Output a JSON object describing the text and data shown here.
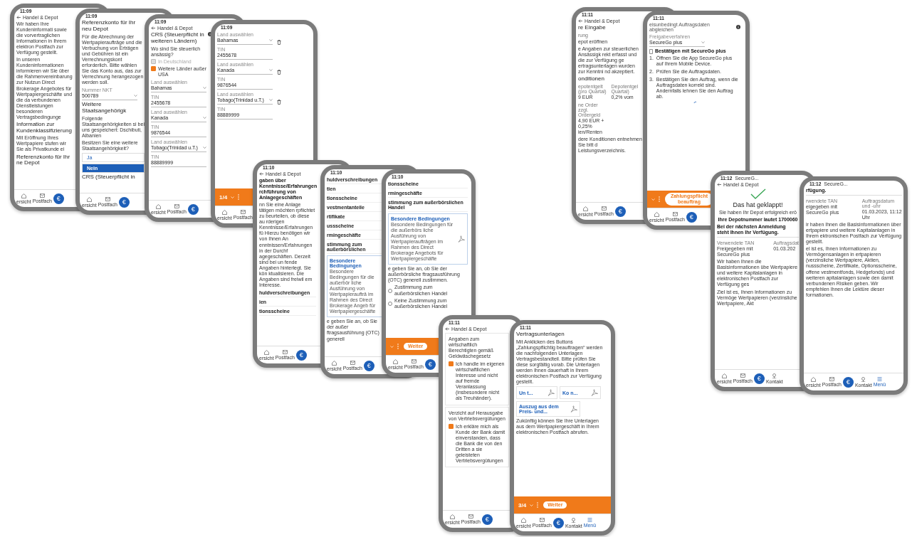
{
  "phones": [
    {
      "time": "11:09",
      "items": [
        {
          "kind": "header",
          "text": "Handel & Depot"
        },
        {
          "kind": "para",
          "text": "Wir haben Ihre Kundeninformati sowie die vorvertraglichen Informationen in Ihrem elektron Postfach zur Verfügung gestellt."
        },
        {
          "kind": "para",
          "text": "In unseren Kundeninformationen informieren wir Sie über die Rahmenvereinbarung zur Nutzun Direct Brokerage Angebotes für Wertpapiergeschäfte und die da verbundenen Dienstleistungen besonderen Vertragsbedingunge"
        },
        {
          "kind": "heading",
          "text": "Information zur Kundenklassifizierung"
        },
        {
          "kind": "para",
          "text": "Mit Eröffnung Ihres Wertpapiere stufen wir Sie als Privatkunde ei"
        },
        {
          "kind": "heading",
          "text": "Referenzkonto für Ihr ne Depot"
        }
      ],
      "nav": {
        "items": [
          {
            "kind": "home",
            "label": "ersicht",
            "selected": false
          },
          {
            "kind": "mail",
            "label": "Postfach",
            "selected": false
          }
        ],
        "fab": "€"
      }
    },
    {
      "time": "11:09",
      "items": [
        {
          "kind": "heading",
          "text": "Referenzkonto für Ihr neu Depot"
        },
        {
          "kind": "para",
          "text": "Für die Abrechnung der Wertpapieraufträge und die Verbuchung von Erträgen und Gebühren ist ein Verrechnungskont erforderlich. Bitte wählen Sie das Konto aus, das zur Verrechnung herangezogen werden soll."
        },
        {
          "kind": "select",
          "label": "Nummer NKT",
          "value": "500789"
        },
        {
          "kind": "heading",
          "text": "Weitere Staatsangehörigk"
        },
        {
          "kind": "para",
          "text": "Folgende Staatsangehörigkeiten si bei uns gespeichert: Dschibuti, Albanien"
        },
        {
          "kind": "para",
          "text": "Besitzen Sie eine weitere Staatsangehörigkeit?"
        },
        {
          "kind": "option",
          "text": "Ja",
          "selected": false
        },
        {
          "kind": "option",
          "text": "Nein",
          "selected": true
        },
        {
          "kind": "heading",
          "text": "CRS (Steuerpflicht in"
        }
      ],
      "nav": {
        "items": [
          {
            "kind": "home",
            "label": "ersicht",
            "selected": false
          },
          {
            "kind": "mail",
            "label": "Postfach",
            "selected": false
          }
        ],
        "fab": "€"
      }
    },
    {
      "time": "11:09",
      "items": [
        {
          "kind": "header",
          "text": "Handel & Depot"
        },
        {
          "kind": "heading_info",
          "text": "CRS (Steuerpflicht in weiteren Ländern)"
        },
        {
          "kind": "para",
          "text": "Wo sind Sie steuerlich ansässig?"
        },
        {
          "kind": "checkbox",
          "text": "In Deutschland",
          "checked": true,
          "disabled": true
        },
        {
          "kind": "checkbox",
          "text": "Weitere Länder außer USA",
          "checked": true,
          "disabled": false
        },
        {
          "kind": "select",
          "label": "Land auswählen",
          "value": "Bahamas"
        },
        {
          "kind": "text_input",
          "label": "TIN",
          "value": "2455678"
        },
        {
          "kind": "select",
          "label": "Land auswählen",
          "value": "Kanada"
        },
        {
          "kind": "text_input",
          "label": "TIN",
          "value": "9876544"
        },
        {
          "kind": "select",
          "label": "Land auswählen",
          "value": "Tobago(Trinidad u.T.)"
        },
        {
          "kind": "text_input",
          "label": "TIN",
          "value": "88889999"
        }
      ],
      "nav": {
        "items": [
          {
            "kind": "home",
            "label": "ersicht",
            "selected": false
          },
          {
            "kind": "mail",
            "label": "Postfach",
            "selected": false
          }
        ],
        "fab": "€"
      }
    },
    {
      "time": "11:09",
      "items": [
        {
          "kind": "select_removable",
          "label": "Land auswählen",
          "value": "Bahamas"
        },
        {
          "kind": "text_input",
          "label": "TIN",
          "value": "2455678"
        },
        {
          "kind": "select_removable",
          "label": "Land auswählen",
          "value": "Kanada"
        },
        {
          "kind": "text_input",
          "label": "TIN",
          "value": "9876544"
        },
        {
          "kind": "select_removable",
          "label": "Land auswählen",
          "value": "Tobago(Trinidad u.T.)"
        },
        {
          "kind": "text_input",
          "label": "TIN",
          "value": "88889999"
        }
      ],
      "action": {
        "step": "1/4"
      },
      "nav": {
        "items": [
          {
            "kind": "home",
            "label": "ersicht",
            "selected": false
          },
          {
            "kind": "mail",
            "label": "Postfach",
            "selected": false
          }
        ]
      }
    },
    {
      "time": "11:10",
      "items": [
        {
          "kind": "header",
          "text": "Handel & Depot"
        },
        {
          "kind": "bold_para",
          "text": "gaben über Kenntnisse/Erfahrungen rchführung von Anlagegeschäften"
        },
        {
          "kind": "para",
          "text": "nn Sie eine Anlage tätigen möchten rpflichtet zu beurteilen, ob diese au rderigen Kenntnisse/Erfahrungen fü Hierzu benötigen wir von Ihnen An enntnissen/Erfahrungen in der Durchf agegeschäften. Derzeit sind bei un fende Angaben hinterlegt. Sie kön ktualisieren. Die Angaben sind freiwil em Interesse."
        },
        {
          "kind": "row",
          "text": "huldverschreibungen"
        },
        {
          "kind": "row",
          "text": "ien"
        },
        {
          "kind": "row",
          "text": "tionsscheine"
        }
      ],
      "nav": {
        "items": [
          {
            "kind": "home",
            "label": "ersicht",
            "selected": false
          },
          {
            "kind": "mail",
            "label": "Postfach",
            "selected": false
          }
        ],
        "fab": "€"
      }
    },
    {
      "time": "11:10",
      "items": [
        {
          "kind": "row",
          "text": "huldverschreibungen"
        },
        {
          "kind": "row",
          "text": "tien"
        },
        {
          "kind": "row",
          "text": "tionsscheine"
        },
        {
          "kind": "row",
          "text": "vestmentanteile"
        },
        {
          "kind": "row",
          "text": "rtifikate"
        },
        {
          "kind": "row",
          "text": "ussscheine"
        },
        {
          "kind": "row",
          "text": "rmingeschäfte"
        },
        {
          "kind": "row",
          "text": "stimmung zum außerbörslichen"
        },
        {
          "kind": "card",
          "title": "Besondere Bedingungen",
          "text": "Besondere Bedingungen für die außerbör liche Ausführung von Wertpapieraufträ im Rahmen des Direct Brokerage Angeb für Wertpapiergeschäfte"
        },
        {
          "kind": "para",
          "text": "e geben Sie an, ob Sie der außer ftragsausführung (OTC) generell"
        }
      ],
      "nav": {
        "items": [
          {
            "kind": "home",
            "label": "ersicht",
            "selected": false
          },
          {
            "kind": "mail",
            "label": "Postfach",
            "selected": false
          }
        ],
        "fab": "€"
      }
    },
    {
      "time": "11:10",
      "items": [
        {
          "kind": "row",
          "text": "tionsscheine"
        },
        {
          "kind": "row",
          "text": "rmingeschäfte"
        },
        {
          "kind": "row",
          "text": "stimmung zum außerbörslichen Handel"
        },
        {
          "kind": "pdf_card",
          "title": "Besondere Bedingungen",
          "text": "Besondere Bedingungen für die außerbörs liche Ausführung von Wertpapieraufträgen im Rahmen des Direct Brokerage Angebots für Wertpapiergeschäfte"
        },
        {
          "kind": "para",
          "text": "e geben Sie an, ob Sie der außerbörsliche ftragsausführung (OTC) generell zustimmen."
        },
        {
          "kind": "radio",
          "text": "Zustimmung zum außerbörslichen Handel",
          "selected": false
        },
        {
          "kind": "radio",
          "text": "Keine Zustimmung zum außerbörslichen Handel",
          "selected": false
        }
      ],
      "action": {
        "button": "Weiter"
      },
      "nav": {
        "items": [
          {
            "kind": "home",
            "label": "ersicht",
            "selected": false
          },
          {
            "kind": "mail",
            "label": "Postfach",
            "selected": false
          }
        ],
        "fab": "€"
      }
    },
    {
      "time": "11:11",
      "items": [
        {
          "kind": "header",
          "text": "Handel & Depot"
        },
        {
          "kind": "check_card",
          "title": "Angaben zum wirtschaftlich Berechtigten gemäß Geldwäschegesetz",
          "text": "Ich handle im eigenen wirtschaftlichen Interesse und nicht auf fremde Veranlassung (insbesondere nicht als Treuhänder).",
          "checked": true
        },
        {
          "kind": "check_card",
          "title": "Verzicht auf Herausgabe von Vertriebsvergütungen",
          "text": "Ich erkläre mich als Kunde der Bank damit einverstanden, dass die Bank die von den Dritten a sie geleisteten Vertriebsvergütungen",
          "checked": true
        }
      ],
      "nav": {
        "items": [
          {
            "kind": "home",
            "label": "ersicht",
            "selected": false
          },
          {
            "kind": "mail",
            "label": "Postfach",
            "selected": false
          }
        ],
        "fab": "€"
      }
    },
    {
      "time": "11:11",
      "items": [
        {
          "kind": "heading",
          "text": "Vertragsunterlagen"
        },
        {
          "kind": "para",
          "text": "Mit Anklicken des Buttons „Zahlungspflichtig beauftragen“ werden die nachfolgenden Unterlagen Vertragsbestandteil. Bitte prüfen Sie diese sorgfältig vorab. Die Unterlagen werden Ihnen dauerhaft in Ihrem elektronischen Postfach zur Verfügung gestellt."
        },
        {
          "kind": "docs",
          "docs": [
            "Un t...",
            "Ko n...",
            "Auszug aus dem Preis- und..."
          ]
        },
        {
          "kind": "para",
          "text": "Zukünftig können Sie Ihre Unterlagen aus dem Wertpapiergeschäft in Ihrem elektronischen Postfach abrufen."
        }
      ],
      "action": {
        "step": "3/4",
        "button": "Weiter"
      },
      "nav": {
        "items": [
          {
            "kind": "home",
            "label": "ersicht",
            "selected": false
          },
          {
            "kind": "mail",
            "label": "Postfach",
            "selected": false
          },
          {
            "kind": "contact",
            "label": "Kontakt",
            "selected": false
          },
          {
            "kind": "menu",
            "label": "Menü",
            "selected": true
          }
        ],
        "fab": "€"
      }
    },
    {
      "time": "11:11",
      "items": [
        {
          "kind": "header",
          "text": "Handel & Depot"
        },
        {
          "kind": "heading",
          "text": "re Eingabe"
        },
        {
          "kind": "small",
          "text": "rung"
        },
        {
          "kind": "para",
          "text": "epot eröffnen"
        },
        {
          "kind": "para",
          "text": "e Angaben zur steuerlichen Ansässigk rekt erfasst und die zur Verfügung ge ertragsunterlagen wurden zur Kenntni nd akzeptiert."
        },
        {
          "kind": "heading",
          "text": "onditionen"
        },
        {
          "kind": "table",
          "cells": [
            [
              "epotentgelt (pro Quartal)",
              "9 EUR"
            ],
            [
              "Depotentgel Quartal)",
              "0,2% vom"
            ],
            [
              "ne Order zzgl. Ordergeld",
              "4,90 EUR + 0,25% ien/Renten"
            ]
          ]
        },
        {
          "kind": "para",
          "text": "dere Konditionen entnehmen Sie bitt d Leistungsverzeichnis."
        }
      ],
      "nav": {
        "items": [
          {
            "kind": "home",
            "label": "ersicht",
            "selected": false
          },
          {
            "kind": "mail",
            "label": "Postfach",
            "selected": false
          }
        ],
        "fab": "€"
      }
    },
    {
      "time": "11:11",
      "items": [
        {
          "kind": "label_info",
          "text": "eisunbedingt Auftragsdaten abgleichen"
        },
        {
          "kind": "select",
          "label": "Freigabeverfahren",
          "value": "SecureGo plus"
        },
        {
          "kind": "confirm",
          "text": "Bestätigen mit SecureGo plus"
        },
        {
          "kind": "steps",
          "steps": [
            {
              "num": "1.",
              "text": "Öffnen Sie die App SecureGo plus auf Ihrem Mobile Device."
            },
            {
              "num": "2.",
              "text": "Prüfen Sie die Auftragsdaten."
            },
            {
              "num": "3.",
              "text": "Bestätigen Sie den Auftrag, wenn die Auftragsdaten korrekt sind. Andernfalls lehnen Sie den Auftrag ab."
            }
          ]
        },
        {
          "kind": "spinner"
        }
      ],
      "action": {
        "button": "Zahlungspflicht beauftrag"
      },
      "nav": {
        "items": [
          {
            "kind": "home",
            "label": "ersicht",
            "selected": false
          },
          {
            "kind": "mail",
            "label": "Postfach",
            "selected": false
          }
        ],
        "fab": "€"
      }
    },
    {
      "time": "11:12",
      "back_app": "SecureG...",
      "items": [
        {
          "kind": "header",
          "text": "Handel & Depot"
        },
        {
          "kind": "check"
        },
        {
          "kind": "title",
          "text": "Das hat geklappt!"
        },
        {
          "kind": "center_para",
          "text": "Sie haben Ihr Depot erfolgreich erö"
        },
        {
          "kind": "center_bold",
          "text": "Ihre Depotnummer lautet 1700060"
        },
        {
          "kind": "bold_para",
          "text": "Bei der nächsten Anmeldung steht Ihnen Ihr Verfügung."
        },
        {
          "kind": "info",
          "cols": [
            [
              "Verwendete TAN",
              "Freigegeben mit SecureGo plus"
            ],
            [
              "Auftragsdat",
              "01.03.202"
            ]
          ]
        },
        {
          "kind": "para",
          "text": "Wir haben Ihnen die Basisinformationen übe Wertpapiere und weitere Kapitalanlagen in elektronischen Postfach zur Verfügung ges"
        },
        {
          "kind": "para",
          "text": "Ziel ist es, Ihnen Informationen zu Vermöge Wertpapieren (verzinsliche Wertpapiere, Akt"
        }
      ],
      "nav": {
        "items": [
          {
            "kind": "home",
            "label": "ersicht",
            "selected": false
          },
          {
            "kind": "mail",
            "label": "Postfach",
            "selected": false
          },
          {
            "kind": "contact",
            "label": "Kontakt",
            "selected": false
          }
        ],
        "fab": "€"
      }
    },
    {
      "time": "11:12",
      "back_app": "SecureG...",
      "items": [
        {
          "kind": "bold_para",
          "text": "rfügung."
        },
        {
          "kind": "info",
          "cols": [
            [
              "rwendete TAN",
              "eigegeben mit SecureGo plus"
            ],
            [
              "Auftragsdatum und -uhr",
              "01.03.2023, 11:12 Uhr"
            ]
          ]
        },
        {
          "kind": "para",
          "text": "ir haben Ihnen die Basisinformationen über ertpapiere und weitere Kapitalanlagen in Ihrem ektronischen Postfach zur Verfügung gestellt."
        },
        {
          "kind": "para",
          "text": "el ist es, Ihnen Informationen zu Vermögensanlagen in ertpapieren (verzinsliche Wertpapiere, Aktien, nussscheine, Zertifikate, Optionsscheine, offene vestmentfonds, Hedgefonds) und weiteren apitalanlagen sowie den damit verbundenen Risiken geben. Wir empfehlen Ihnen die Lektüre dieser formationen."
        }
      ],
      "nav": {
        "items": [
          {
            "kind": "home",
            "label": "ersicht",
            "selected": false
          },
          {
            "kind": "mail",
            "label": "Postfach",
            "selected": false
          },
          {
            "kind": "contact",
            "label": "Kontakt",
            "selected": false
          },
          {
            "kind": "menu",
            "label": "Menü",
            "selected": true
          }
        ],
        "fab": "€"
      }
    }
  ]
}
